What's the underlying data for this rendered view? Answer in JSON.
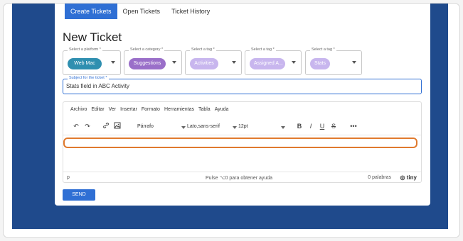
{
  "tabs": [
    "Create Tickets",
    "Open Tickets",
    "Ticket History"
  ],
  "page_title": "New Ticket",
  "selects": [
    {
      "label": "Select a platform *",
      "value": "Web Mac",
      "chip_color": "#2f8fb0"
    },
    {
      "label": "Select a category *",
      "value": "Suggestions",
      "chip_color": "#9a6fc9"
    },
    {
      "label": "Select a tag *",
      "value": "Activities",
      "chip_color": "#c8b6ee"
    },
    {
      "label": "Select a tag *",
      "value": "Assigned A...",
      "chip_color": "#c8b6ee"
    },
    {
      "label": "Select a tag *",
      "value": "Stats",
      "chip_color": "#c8b6ee"
    }
  ],
  "subject": {
    "label": "Subject for the ticket *",
    "value": "Stats field in ABC Activity"
  },
  "editor": {
    "menu": [
      "Archivo",
      "Editar",
      "Ver",
      "Insertar",
      "Formato",
      "Herramientas",
      "Tabla",
      "Ayuda"
    ],
    "toolbar": {
      "block_format": "Párrafo",
      "font_family": "Lato,sans-serif",
      "font_size": "12pt",
      "bold": "B",
      "italic": "I",
      "underline": "U",
      "strike": "S",
      "more": "•••"
    },
    "status": {
      "path": "p",
      "hint": "Pulse ⌥0 para obtener ayuda",
      "words": "0 palabras",
      "brand": "tiny"
    }
  },
  "send_label": "SEND",
  "colors": {
    "accent": "#2f6fd4",
    "background": "#1f4a8c",
    "highlight": "#e07a2e"
  }
}
